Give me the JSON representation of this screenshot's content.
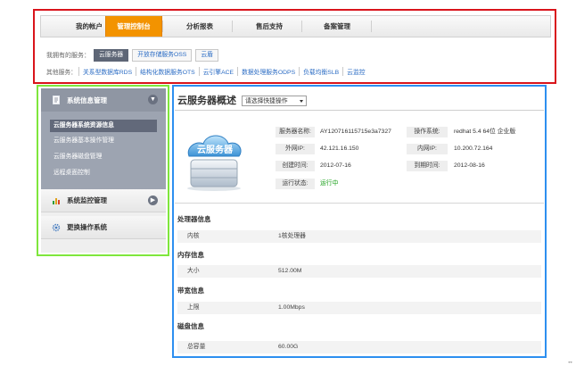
{
  "top_nav": {
    "items": [
      "我的帐户",
      "管理控制台",
      "分析报表",
      "售后支持",
      "备案管理"
    ],
    "active_index": 1,
    "accent_color": "#f39300"
  },
  "services": {
    "title": "我拥有的服务：",
    "tabs": [
      "云服务器",
      "开放存储服务OSS",
      "云盾"
    ],
    "active_index": 0
  },
  "other_services": {
    "label": "其他服务：",
    "links": [
      "关系型数据库RDS",
      "结构化数据服务OTS",
      "云引擎ACE",
      "数据处理服务ODPS",
      "负载均衡SLB",
      "云监控"
    ]
  },
  "sidebar": {
    "groups": [
      {
        "label": "系统信息管理",
        "icon": "document-icon",
        "expanded": true,
        "items": [
          "云服务器系统资源信息",
          "云服务器基本操作管理",
          "云服务器磁盘管理",
          "远程桌面控制"
        ],
        "active_item": 0
      },
      {
        "label": "系统监控管理",
        "icon": "bar-chart-icon",
        "expanded": false
      },
      {
        "label": "更换操作系统",
        "icon": "gear-icon",
        "expanded": false
      }
    ]
  },
  "main": {
    "title": "云服务器概述",
    "quick_select": "请选择快捷操作",
    "logo_text": "云服务器",
    "fields": [
      {
        "label": "服务器名称:",
        "value": "AY120716115715e3a7327"
      },
      {
        "label": "操作系统:",
        "value": "redhat 5.4 64位 企业版"
      },
      {
        "label": "外网IP:",
        "value": "42.121.16.150"
      },
      {
        "label": "内网IP:",
        "value": "10.200.72.164"
      },
      {
        "label": "创建时间:",
        "value": "2012-07-16"
      },
      {
        "label": "到期时间:",
        "value": "2012-08-16"
      },
      {
        "label": "运行状态:",
        "value": "运行中"
      }
    ],
    "status_color": "#1aa01a",
    "sections": [
      {
        "title": "处理器信息",
        "row_label": "内核",
        "row_value": "1核处理器"
      },
      {
        "title": "内存信息",
        "row_label": "大小",
        "row_value": "512.00M"
      },
      {
        "title": "带宽信息",
        "row_label": "上限",
        "row_value": "1.00Mbps"
      },
      {
        "title": "磁盘信息",
        "row_label": "总容量",
        "row_value": "60.00G"
      }
    ]
  },
  "annotations": {
    "header_box_color": "#d9141b",
    "sidebar_box_color": "#7fe63c",
    "main_box_color": "#2d8ff0"
  }
}
